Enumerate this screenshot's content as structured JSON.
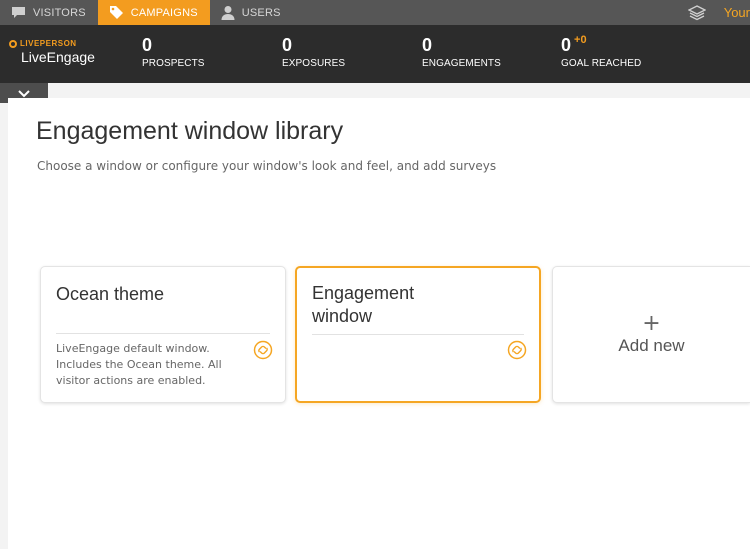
{
  "nav": {
    "tabs": [
      {
        "label": "VISITORS",
        "icon": "chat-bubble-icon",
        "active": false
      },
      {
        "label": "CAMPAIGNS",
        "icon": "tag-icon",
        "active": true
      },
      {
        "label": "USERS",
        "icon": "user-icon",
        "active": false
      }
    ],
    "right_icon": "layers-icon",
    "right_text": "Your"
  },
  "brand": {
    "company": "LIVEPERSON",
    "product": "LiveEngage"
  },
  "stats": [
    {
      "value": "0",
      "label": "PROSPECTS"
    },
    {
      "value": "0",
      "label": "EXPOSURES"
    },
    {
      "value": "0",
      "label": "ENGAGEMENTS"
    },
    {
      "value": "0",
      "delta": "+0",
      "label": "GOAL REACHED"
    }
  ],
  "collapse_icon": "chevron-down-icon",
  "page": {
    "title": "Engagement window library",
    "subtitle": "Choose a window or configure your window's look and feel, and add surveys"
  },
  "cards": [
    {
      "title": "Ocean theme",
      "description": "LiveEngage default window. Includes the Ocean theme. All visitor actions are enabled.",
      "icon": "link-icon",
      "selected": false
    },
    {
      "title": "Engagement window",
      "description": "",
      "icon": "link-icon",
      "selected": true
    }
  ],
  "add_card": {
    "plus": "+",
    "label": "Add new"
  },
  "colors": {
    "accent": "#f39c1f",
    "nav_bg": "#565656",
    "stats_bg": "#2c2c2c",
    "selected_border": "#f5a623"
  }
}
